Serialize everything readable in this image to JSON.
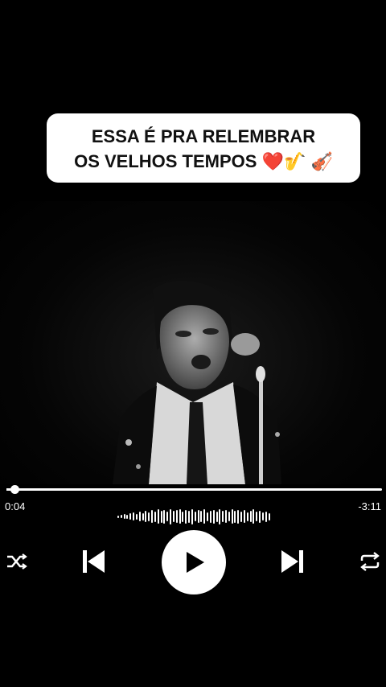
{
  "caption": {
    "line1": "ESSA É PRA RELEMBRAR",
    "line2": "OS VELHOS TEMPOS",
    "emojis": [
      "❤️",
      "🎷",
      "🎻"
    ]
  },
  "player": {
    "elapsed": "0:04",
    "remaining": "-3:11",
    "progress_fraction": 0.021,
    "icons": {
      "shuffle": "shuffle-icon",
      "previous": "skip-previous-icon",
      "play": "play-icon",
      "next": "skip-next-icon",
      "repeat": "repeat-icon"
    }
  },
  "colors": {
    "background": "#000000",
    "caption_bg": "#ffffff",
    "caption_text": "#111111",
    "controls": "#ffffff"
  }
}
